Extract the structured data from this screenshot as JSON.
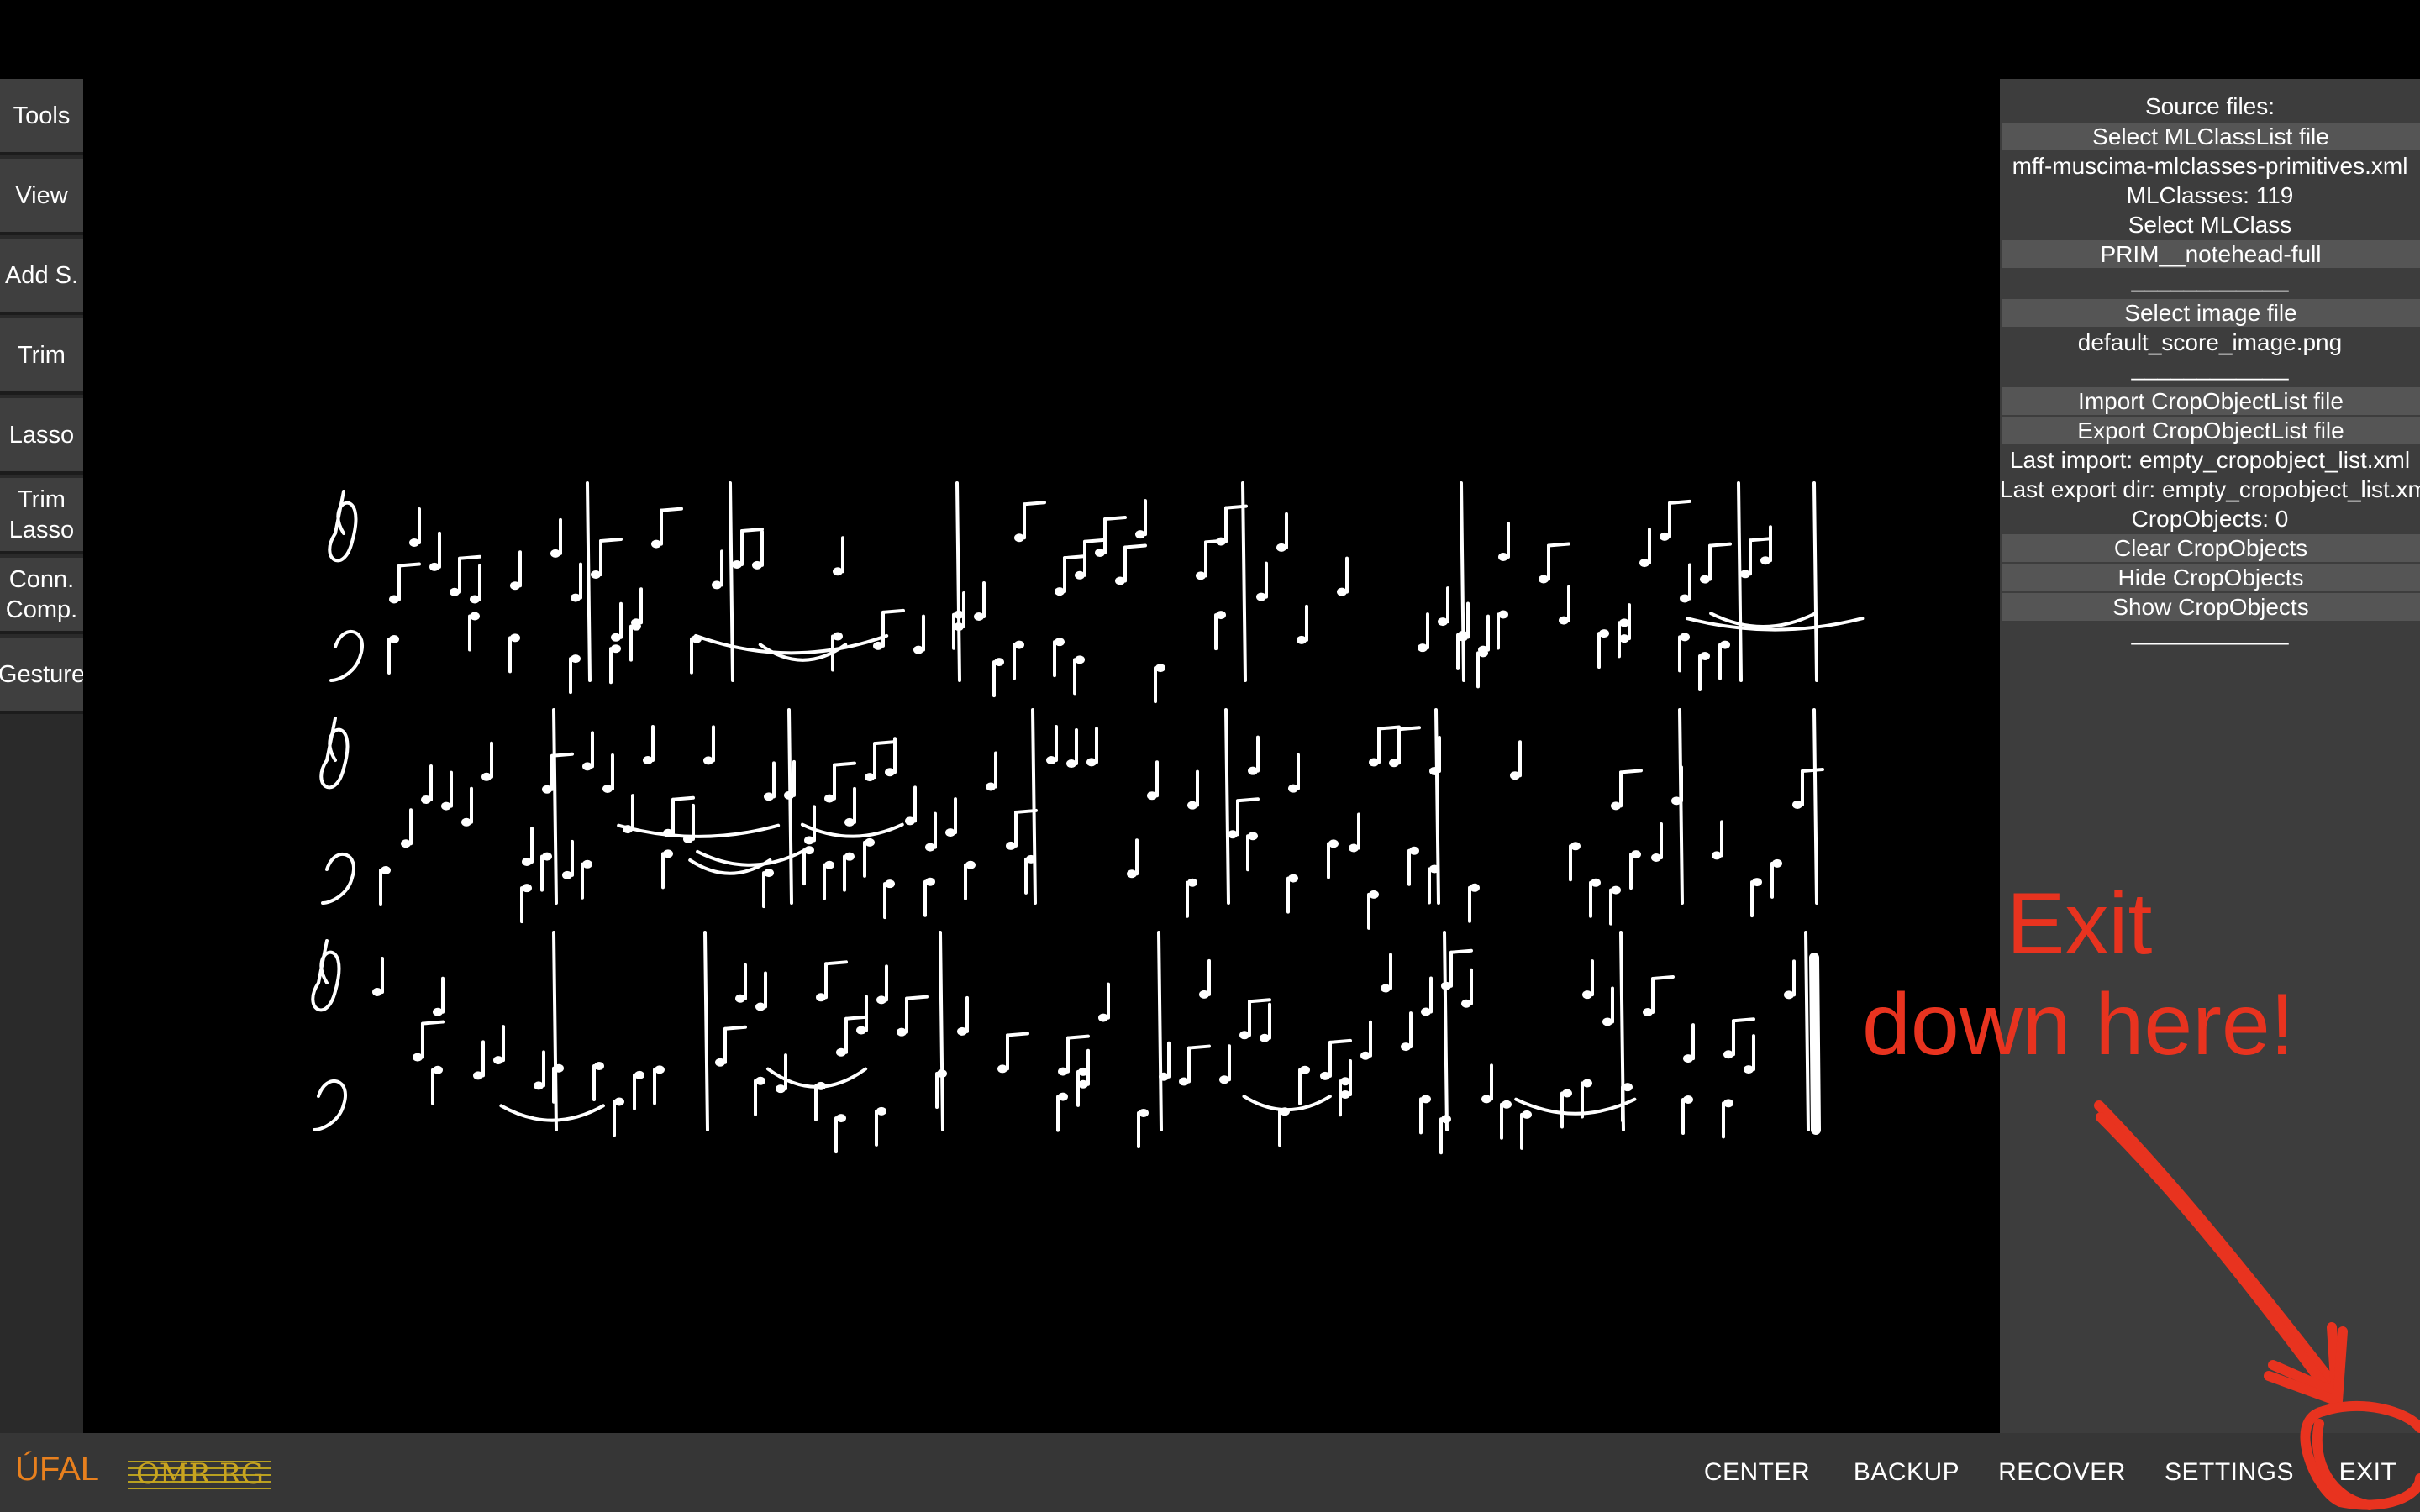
{
  "left_toolbar": {
    "tools": [
      {
        "id": "tools",
        "label": "Tools"
      },
      {
        "id": "view",
        "label": "View"
      },
      {
        "id": "add-s",
        "label": "Add S."
      },
      {
        "id": "trim",
        "label": "Trim"
      },
      {
        "id": "lasso",
        "label": "Lasso"
      },
      {
        "id": "trim-lasso",
        "label": "Trim\nLasso"
      },
      {
        "id": "conn-comp",
        "label": "Conn.\nComp."
      },
      {
        "id": "gesture",
        "label": "Gesture"
      }
    ]
  },
  "right_panel": {
    "source_files_heading": "Source files:",
    "select_mlclasslist_button": "Select MLClassList file",
    "mlclasslist_filename": "mff-muscima-mlclasses-primitives.xml",
    "mlclasses_count": "MLClasses: 119",
    "select_mlclass_label": "Select MLClass",
    "selected_mlclass": "PRIM__notehead-full",
    "separator_1": "____________",
    "select_image_button": "Select image file",
    "image_filename": "default_score_image.png",
    "separator_2": "____________",
    "import_button": "Import CropObjectList file",
    "export_button": "Export CropObjectList file",
    "last_import": "Last import: empty_cropobject_list.xml",
    "last_export_dir": "Last export dir: empty_cropobject_list.xml",
    "cropobjects_count": "CropObjects: 0",
    "clear_button": "Clear CropObjects",
    "hide_button": "Hide CropObjects",
    "show_button": "Show CropObjects",
    "separator_3": "____________"
  },
  "bottom_bar": {
    "logo_ufal_text": "ÚFAL",
    "logo_omr_text": "OMR RG",
    "buttons": {
      "center": "CENTER",
      "backup": "BACKUP",
      "recover": "RECOVER",
      "settings": "SETTINGS",
      "exit": "EXIT"
    }
  },
  "annotation": {
    "line1": "Exit",
    "line2": "down here!",
    "color": "#e8331f"
  },
  "colors": {
    "background": "#000000",
    "panel": "#3d3d3d",
    "button": "#555555",
    "bottom_bar": "#363636",
    "annotation_red": "#e8331f",
    "logo_orange": "#e8801e"
  }
}
